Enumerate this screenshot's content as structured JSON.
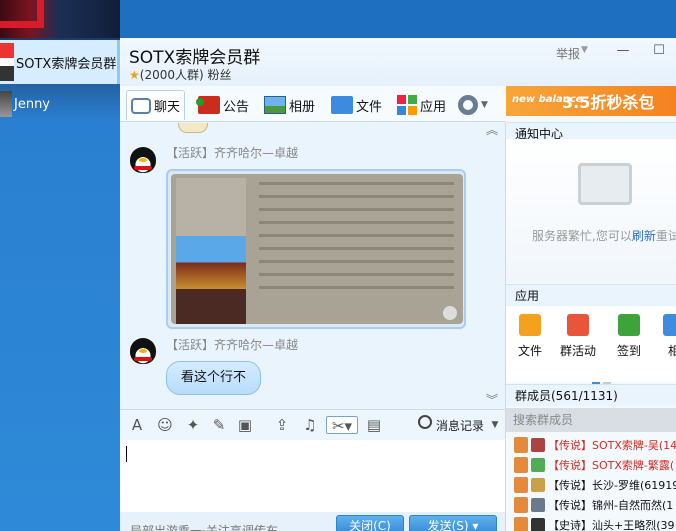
{
  "sessions": [
    {
      "name": "SOTX索牌会员群",
      "active": true
    },
    {
      "name": "Jenny",
      "active": false
    }
  ],
  "window": {
    "title": "SOTX索牌会员群",
    "subtitle": "(2000人群) 粉丝",
    "report_label": "举报",
    "controls": {
      "minimize": "—",
      "maximize": "☐"
    }
  },
  "tabs": [
    {
      "label": "聊天",
      "active": true
    },
    {
      "label": "公告"
    },
    {
      "label": "相册"
    },
    {
      "label": "文件"
    },
    {
      "label": "应用"
    }
  ],
  "messages": [
    {
      "sender": "【活跃】齐齐哈尔—卓越",
      "type": "image"
    },
    {
      "sender": "【活跃】齐齐哈尔—卓越",
      "type": "text",
      "text": "看这个行不"
    }
  ],
  "collapse_label": "︽",
  "expand_label": "︾",
  "toolbar": {
    "history_label": "消息记录",
    "icons": [
      "font-icon",
      "emoji-icon",
      "magic-icon",
      "edit-icon",
      "image-icon",
      "upload-icon",
      "music-icon",
      "scissors-icon",
      "screen-icon"
    ]
  },
  "footer": {
    "tip": "局部出游乘一·关注高调传布",
    "close_label": "关闭(C)",
    "send_label": "发送(S)"
  },
  "right": {
    "ad_brand": "new balance",
    "ad_text": "3.5折秒杀包",
    "notice_header": "通知中心",
    "notice_text_before": "服务器繁忙,您可以",
    "notice_link": "刷新",
    "notice_text_after": "重试",
    "apps_header": "应用",
    "apps": [
      {
        "label": "文件",
        "color": "#f4a21d"
      },
      {
        "label": "群活动",
        "color": "#e8553b"
      },
      {
        "label": "签到",
        "color": "#3ea33b"
      },
      {
        "label": "相",
        "color": "#3c8de0"
      }
    ],
    "members_header": "群成员(561/1131)",
    "member_search_placeholder": "搜索群成员",
    "members": [
      {
        "text": "【传说】SOTX索牌-吴(143",
        "color": "#d42a1f"
      },
      {
        "text": "【传说】SOTX索牌-繁露(",
        "color": "#d42a1f"
      },
      {
        "text": "【传说】长沙-罗维(61919",
        "color": "#111111"
      },
      {
        "text": "【传说】锦州-自然而然(1",
        "color": "#111111"
      },
      {
        "text": "【史诗】汕头+王略烈(39",
        "color": "#111111"
      }
    ]
  }
}
